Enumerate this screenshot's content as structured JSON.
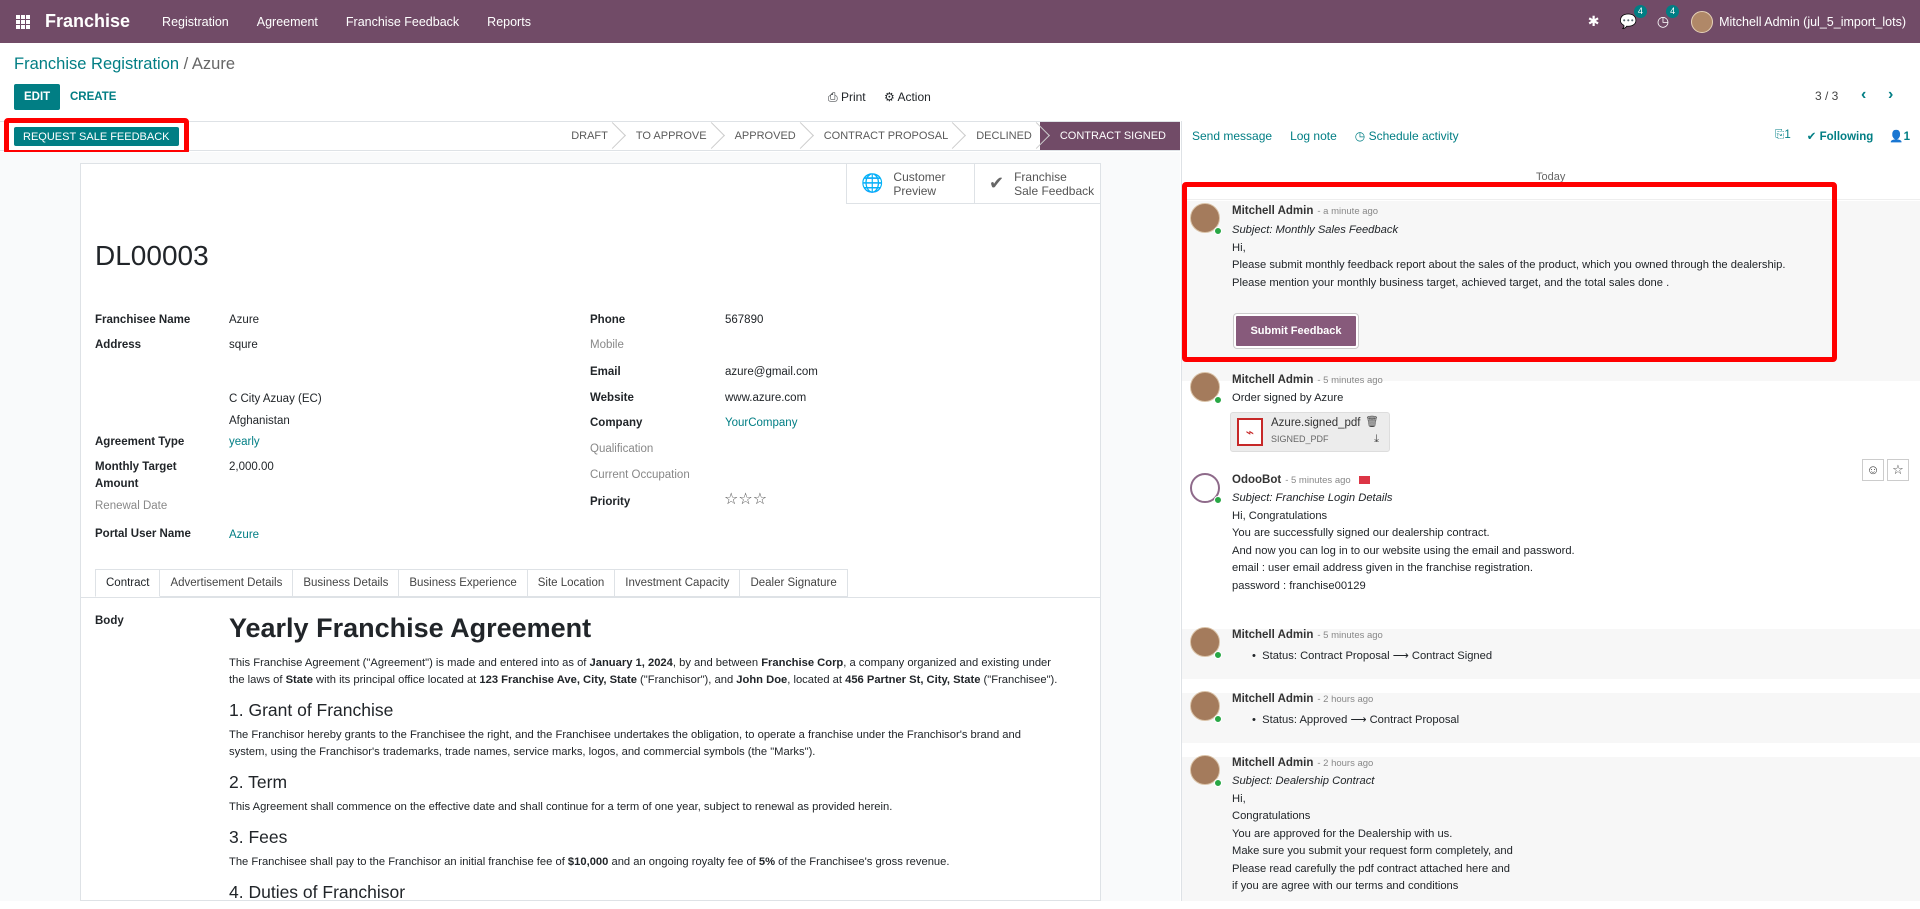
{
  "topbar": {
    "app_name": "Franchise",
    "menu": [
      "Registration",
      "Agreement",
      "Franchise Feedback",
      "Reports"
    ],
    "messages_count": "4",
    "activities_count": "4",
    "user": "Mitchell Admin (jul_5_import_lots)"
  },
  "breadcrumb": {
    "parent": "Franchise Registration",
    "separator": " / ",
    "current": "Azure"
  },
  "control": {
    "edit": "EDIT",
    "create": "CREATE",
    "print": "Print",
    "action": "Action",
    "pager": "3 / 3"
  },
  "header": {
    "request_button": "REQUEST SALE FEEDBACK",
    "stages": [
      "DRAFT",
      "TO APPROVE",
      "APPROVED",
      "CONTRACT PROPOSAL",
      "DECLINED",
      "CONTRACT SIGNED"
    ],
    "active_stage": "CONTRACT SIGNED"
  },
  "smart_buttons": {
    "customer_preview": [
      "Customer",
      "Preview"
    ],
    "sale_feedback": [
      "Franchise",
      "Sale Feedback"
    ]
  },
  "record": {
    "name": "DL00003",
    "fields_left": {
      "franchisee_name_label": "Franchisee Name",
      "franchisee_name": "Azure",
      "address_label": "Address",
      "street": "squre",
      "city_state": "C City  Azuay (EC)",
      "country": "Afghanistan",
      "agreement_type_label": "Agreement Type",
      "agreement_type": "yearly",
      "monthly_target_label_1": "Monthly Target",
      "monthly_target_label_2": "Amount",
      "monthly_target": "2,000.00",
      "renewal_date_label": "Renewal Date",
      "portal_user_label": "Portal User Name",
      "portal_user": "Azure"
    },
    "fields_right": {
      "phone_label": "Phone",
      "phone": "567890",
      "mobile_label": "Mobile",
      "email_label": "Email",
      "email": "azure@gmail.com",
      "website_label": "Website",
      "website": "www.azure.com",
      "company_label": "Company",
      "company": "YourCompany",
      "qualification_label": "Qualification",
      "occupation_label": "Current Occupation",
      "priority_label": "Priority",
      "priority_stars": 0
    }
  },
  "tabs": [
    "Contract",
    "Advertisement Details",
    "Business Details",
    "Business Experience",
    "Site Location",
    "Investment Capacity",
    "Dealer Signature"
  ],
  "contract": {
    "body_label": "Body",
    "title": "Yearly Franchise Agreement",
    "intro": {
      "t1": "This Franchise Agreement (\"Agreement\") is made and entered into as of ",
      "b1": "January 1, 2024",
      "t2": ", by and between ",
      "b2": "Franchise Corp",
      "t3": ", a company organized and existing under the laws of ",
      "b3": "State",
      "t4": " with its principal office located at ",
      "b4": "123 Franchise Ave, City, State",
      "t5": " (\"Franchisor\"), and ",
      "b5": "John Doe",
      "t6": ", located at ",
      "b6": "456 Partner St, City, State",
      "t7": " (\"Franchisee\")."
    },
    "s1_title": "1. Grant of Franchise",
    "s1_text": "The Franchisor hereby grants to the Franchisee the right, and the Franchisee undertakes the obligation, to operate a franchise under the Franchisor's brand and system, using the Franchisor's trademarks, trade names, service marks, logos, and commercial symbols (the \"Marks\").",
    "s2_title": "2. Term",
    "s2_text": "This Agreement shall commence on the effective date and shall continue for a term of one year, subject to renewal as provided herein.",
    "s3_title": "3. Fees",
    "s3_t1": "The Franchisee shall pay to the Franchisor an initial franchise fee of ",
    "s3_b1": "$10,000",
    "s3_t2": " and an ongoing royalty fee of ",
    "s3_b2": "5%",
    "s3_t3": " of the Franchisee's gross revenue.",
    "s4_title": "4. Duties of Franchisor"
  },
  "chatter": {
    "send_message": "Send message",
    "log_note": "Log note",
    "schedule_activity": "Schedule activity",
    "attachments": "1",
    "following": "Following",
    "followers": "1",
    "today": "Today",
    "messages": [
      {
        "author": "Mitchell Admin",
        "time": "- a minute ago",
        "subject": "Subject: Monthly Sales Feedback",
        "lines": [
          "Hi,",
          "Please submit monthly feedback report about the sales of the product, which you owned through the dealership.",
          "Please mention your monthly business target, achieved target, and the total sales done ."
        ],
        "button": "Submit Feedback"
      },
      {
        "author": "Mitchell Admin",
        "time": "- 5 minutes ago",
        "lines": [
          "Order signed by Azure"
        ],
        "attachment": {
          "name": "Azure.signed_pdf",
          "type": "SIGNED_PDF"
        }
      },
      {
        "author": "OdooBot",
        "time": "- 5 minutes ago",
        "subject": "Subject: Franchise Login Details",
        "lines": [
          "Hi, Congratulations",
          "You are successfully signed our dealership contract.",
          "And now you can log in to our website using the email and password.",
          "email : user email address given in the franchise registration.",
          "password : franchise00129"
        ]
      },
      {
        "author": "Mitchell Admin",
        "time": "- 5 minutes ago",
        "lines": [
          "Status: Contract Proposal ⟶ Contract Signed"
        ]
      },
      {
        "author": "Mitchell Admin",
        "time": "- 2 hours ago",
        "lines": [
          "Status: Approved ⟶ Contract Proposal"
        ]
      },
      {
        "author": "Mitchell Admin",
        "time": "- 2 hours ago",
        "subject": "Subject: Dealership Contract",
        "lines": [
          "Hi,",
          "Congratulations",
          "You are approved for the Dealership with us.",
          "Make sure you submit your request form completely, and",
          "Please read carefully the pdf contract attached here and",
          "if you are agree with our terms and conditions"
        ]
      }
    ]
  },
  "colors": {
    "brand": "#714B67",
    "accent": "#017e84",
    "highlight": "#ff0000"
  }
}
